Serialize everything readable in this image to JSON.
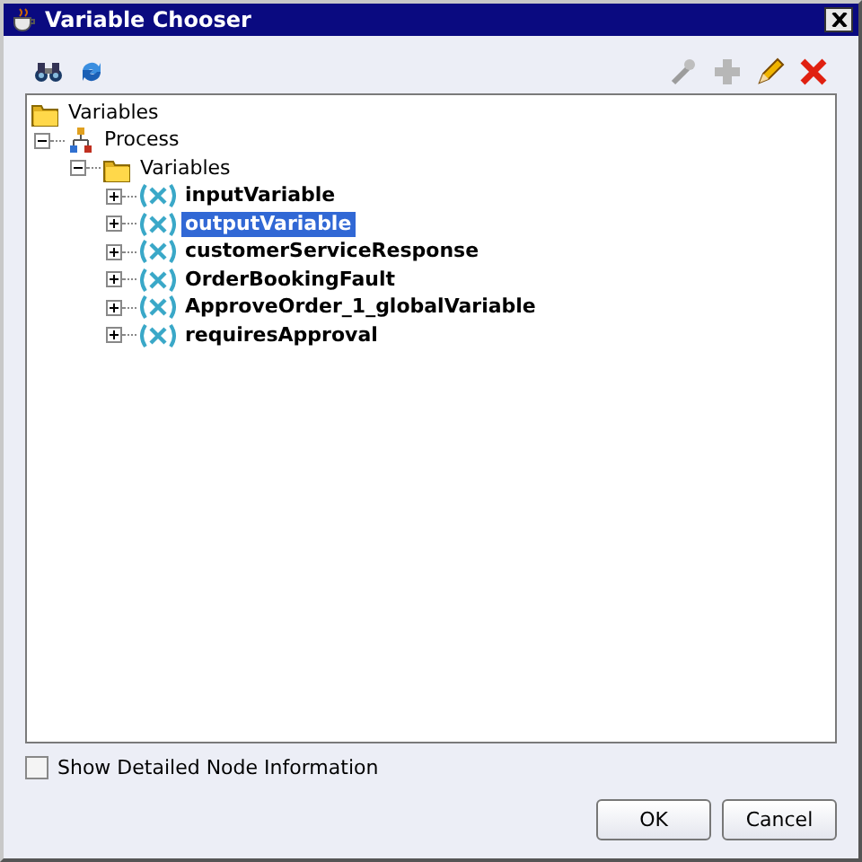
{
  "window": {
    "title": "Variable Chooser"
  },
  "toolbar_left": [
    {
      "kind": "find",
      "disabled": false
    },
    {
      "kind": "refresh",
      "disabled": false
    }
  ],
  "toolbar_right": [
    {
      "kind": "wand",
      "disabled": true
    },
    {
      "kind": "add",
      "disabled": true
    },
    {
      "kind": "edit",
      "disabled": false
    },
    {
      "kind": "delete",
      "disabled": false
    }
  ],
  "tree": [
    {
      "label": "Variables",
      "kind": "folder",
      "selected": false,
      "children": [
        {
          "label": "Process",
          "kind": "process",
          "expanded": true,
          "selected": false,
          "children": [
            {
              "label": "Variables",
              "kind": "folder",
              "expanded": true,
              "selected": false,
              "children": [
                {
                  "label": "inputVariable",
                  "kind": "variable",
                  "expanded": false,
                  "selected": false
                },
                {
                  "label": "outputVariable",
                  "kind": "variable",
                  "expanded": false,
                  "selected": true
                },
                {
                  "label": "customerServiceResponse",
                  "kind": "variable",
                  "expanded": false,
                  "selected": false
                },
                {
                  "label": "OrderBookingFault",
                  "kind": "variable",
                  "expanded": false,
                  "selected": false
                },
                {
                  "label": "ApproveOrder_1_globalVariable",
                  "kind": "variable",
                  "expanded": false,
                  "selected": false
                },
                {
                  "label": "requiresApproval",
                  "kind": "variable",
                  "expanded": false,
                  "selected": false
                }
              ]
            }
          ]
        }
      ]
    }
  ],
  "show_detailed_node_information": {
    "label": "Show Detailed Node Information",
    "checked": false
  },
  "buttons": [
    {
      "label": "OK"
    },
    {
      "label": "Cancel"
    }
  ]
}
